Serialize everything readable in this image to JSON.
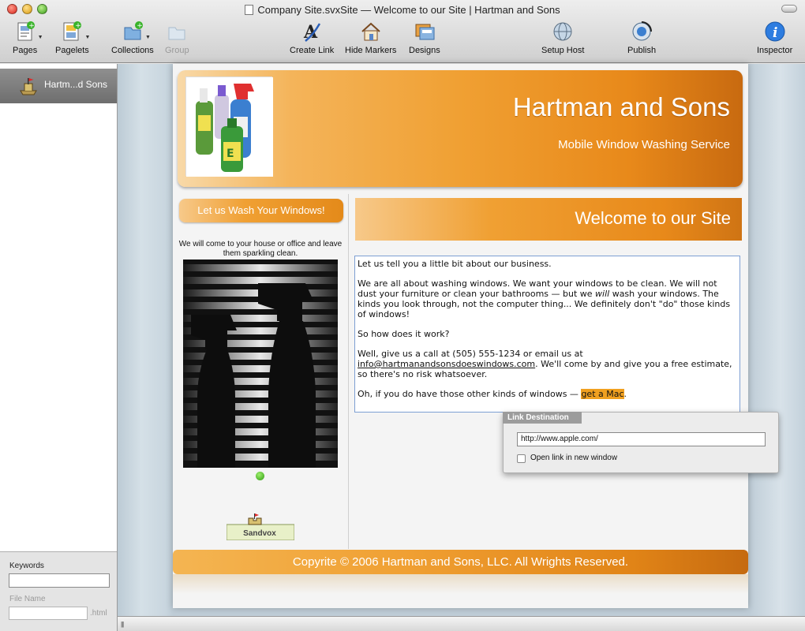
{
  "window": {
    "title": "Company Site.svxSite — Welcome to our Site | Hartman and Sons"
  },
  "toolbar": {
    "pages": "Pages",
    "pagelets": "Pagelets",
    "collections": "Collections",
    "group": "Group",
    "create_link": "Create Link",
    "hide_markers": "Hide Markers",
    "designs": "Designs",
    "setup_host": "Setup Host",
    "publish": "Publish",
    "inspector": "Inspector"
  },
  "sidebar": {
    "selected_item": "Hartm...d Sons",
    "keywords_label": "Keywords",
    "keywords_value": "",
    "file_name_label": "File Name",
    "file_name_value": "",
    "file_ext": ".html"
  },
  "site": {
    "title": "Hartman and Sons",
    "subtitle": "Mobile Window Washing Service",
    "side_banner": "Let us Wash Your Windows!",
    "side_text": "We will come to your house or office and leave them sparkling clean.",
    "sandvox_badge": "Sandvox",
    "page_heading": "Welcome to our Site",
    "body": {
      "p1": "Let us tell you a little bit about our business.",
      "p2a": "We are all about washing windows.  We want your windows to be clean.  We will not dust your furniture or clean your bathrooms — but we ",
      "p2_em": "will",
      "p2b": " wash your windows.  The kinds you look through, not the computer thing... We definitely don't \"do\" those kinds of windows!",
      "p3": "So how does it work?",
      "p4a": "Well, give us a call at (505) 555-1234 or email us at ",
      "p4_email": "info@hartmanandsonsdoeswindows.com",
      "p4b": ".  We'll come by and give you a free estimate, so there's no risk whatsoever.",
      "p5a": "Oh, if you do have those other kinds of windows — ",
      "p5_link": "get a Mac",
      "p5b": "."
    },
    "footer": "Copyrite © 2006 Hartman and Sons, LLC.  All Wrights Reserved."
  },
  "link_popup": {
    "title": "Link Destination",
    "url": "http://www.apple.com/",
    "new_window_label": "Open link in new window",
    "new_window_checked": false
  },
  "colors": {
    "accent_orange": "#f0a033",
    "deep_orange": "#c86a10",
    "highlight": "#f0a020",
    "selection_border": "#7d9fd3"
  }
}
